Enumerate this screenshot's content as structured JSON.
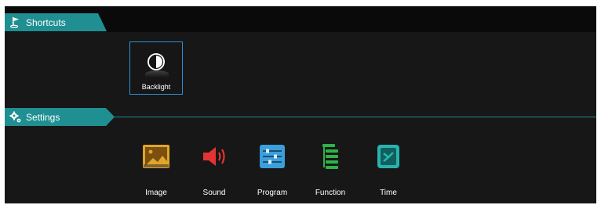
{
  "shortcuts": {
    "title": "Shortcuts",
    "items": [
      {
        "label": "Backlight",
        "icon": "backlight-icon"
      }
    ]
  },
  "settings": {
    "title": "Settings",
    "items": [
      {
        "label": "Image",
        "icon": "image-icon",
        "color": "#e1a529"
      },
      {
        "label": "Sound",
        "icon": "sound-icon",
        "color": "#e23434"
      },
      {
        "label": "Program",
        "icon": "program-icon",
        "color": "#3a9fda"
      },
      {
        "label": "Function",
        "icon": "function-icon",
        "color": "#2eb34a"
      },
      {
        "label": "Time",
        "icon": "time-icon",
        "color": "#29b3b0"
      }
    ]
  },
  "colors": {
    "accent": "#1f8f92",
    "focus": "#2f8fd0",
    "background": "#171717"
  }
}
